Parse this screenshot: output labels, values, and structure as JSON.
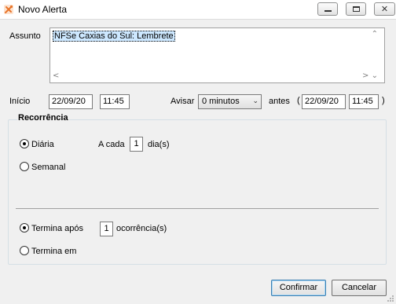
{
  "window": {
    "title": "Novo Alerta",
    "icon": "tools-app-icon",
    "controls": {
      "minimize": "minimize-icon",
      "maximize": "maximize-icon",
      "close": "✕"
    }
  },
  "subject": {
    "label": "Assunto",
    "value": "NFSe Caxias do Sul: Lembrete"
  },
  "start": {
    "label": "Início",
    "date": "22/09/20",
    "time": "11:45"
  },
  "notify": {
    "label": "Avisar",
    "selected": "0 minutos",
    "before_label": "antes",
    "open_paren": "(",
    "date": "22/09/20",
    "time": "11:45",
    "close_paren": ")"
  },
  "recurrence": {
    "title": "Recorrência",
    "daily_label": "Diária",
    "weekly_label": "Semanal",
    "every_label": "A cada",
    "every_value": "1",
    "days_label": "dia(s)",
    "ends_after_label": "Termina após",
    "occurrences_value": "1",
    "occurrences_label": "ocorrência(s)",
    "ends_on_label": "Termina em",
    "selected_frequency": "Diária",
    "selected_end": "Termina após"
  },
  "buttons": {
    "confirm": "Confirmar",
    "cancel": "Cancelar"
  },
  "colors": {
    "accent": "#3c7fb1",
    "selection": "#cde8ff",
    "app_icon": "#e8742a"
  }
}
